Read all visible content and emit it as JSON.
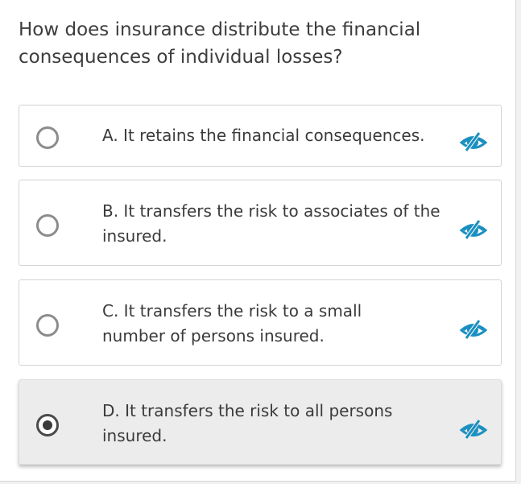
{
  "question": {
    "text": "How does insurance distribute the financial consequences of individual losses?"
  },
  "options": [
    {
      "label": "A. It retains the financial consequences.",
      "selected": false,
      "hide_icon": "eye-slash-icon"
    },
    {
      "label": "B. It transfers the risk to associates of the insured.",
      "selected": false,
      "hide_icon": "eye-slash-icon"
    },
    {
      "label": "C. It transfers the risk to a small number of persons insured.",
      "selected": false,
      "hide_icon": "eye-slash-icon"
    },
    {
      "label": "D. It transfers the risk to all persons insured.",
      "selected": true,
      "hide_icon": "eye-slash-icon"
    }
  ],
  "colors": {
    "accent": "#1a8fc0",
    "selected_bg": "#ececec"
  }
}
